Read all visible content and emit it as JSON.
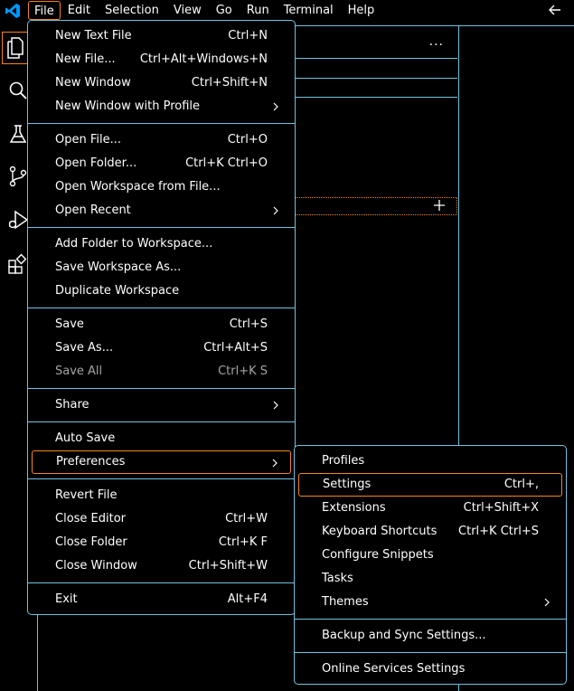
{
  "menubar": {
    "items": [
      "File",
      "Edit",
      "Selection",
      "View",
      "Go",
      "Run",
      "Terminal",
      "Help"
    ]
  },
  "file_menu": {
    "groups": [
      [
        {
          "label": "New Text File",
          "shortcut": "Ctrl+N"
        },
        {
          "label": "New File...",
          "shortcut": "Ctrl+Alt+Windows+N"
        },
        {
          "label": "New Window",
          "shortcut": "Ctrl+Shift+N"
        },
        {
          "label": "New Window with Profile",
          "submenu": true
        }
      ],
      [
        {
          "label": "Open File...",
          "shortcut": "Ctrl+O"
        },
        {
          "label": "Open Folder...",
          "shortcut": "Ctrl+K Ctrl+O"
        },
        {
          "label": "Open Workspace from File..."
        },
        {
          "label": "Open Recent",
          "submenu": true
        }
      ],
      [
        {
          "label": "Add Folder to Workspace..."
        },
        {
          "label": "Save Workspace As..."
        },
        {
          "label": "Duplicate Workspace"
        }
      ],
      [
        {
          "label": "Save",
          "shortcut": "Ctrl+S"
        },
        {
          "label": "Save As...",
          "shortcut": "Ctrl+Alt+S"
        },
        {
          "label": "Save All",
          "shortcut": "Ctrl+K S",
          "disabled": true
        }
      ],
      [
        {
          "label": "Share",
          "submenu": true
        }
      ],
      [
        {
          "label": "Auto Save"
        },
        {
          "label": "Preferences",
          "submenu": true,
          "highlight": true
        }
      ],
      [
        {
          "label": "Revert File"
        },
        {
          "label": "Close Editor",
          "shortcut": "Ctrl+W"
        },
        {
          "label": "Close Folder",
          "shortcut": "Ctrl+K F"
        },
        {
          "label": "Close Window",
          "shortcut": "Ctrl+Shift+W"
        }
      ],
      [
        {
          "label": "Exit",
          "shortcut": "Alt+F4"
        }
      ]
    ]
  },
  "preferences_menu": {
    "groups": [
      [
        {
          "label": "Profiles"
        },
        {
          "label": "Settings",
          "shortcut": "Ctrl+,",
          "highlight": true
        },
        {
          "label": "Extensions",
          "shortcut": "Ctrl+Shift+X"
        },
        {
          "label": "Keyboard Shortcuts",
          "shortcut": "Ctrl+K Ctrl+S"
        },
        {
          "label": "Configure Snippets"
        },
        {
          "label": "Tasks"
        },
        {
          "label": "Themes",
          "submenu": true
        }
      ],
      [
        {
          "label": "Backup and Sync Settings..."
        }
      ],
      [
        {
          "label": "Online Services Settings"
        }
      ]
    ]
  },
  "sidepanel": {
    "more_actions": "..."
  },
  "icons": {
    "app": "vscode-logo-icon",
    "back": "arrow-left-icon",
    "activity": [
      "explorer-icon",
      "search-icon",
      "testing-icon",
      "source-control-icon",
      "run-debug-icon",
      "extensions-icon"
    ]
  },
  "colors": {
    "background": "#000000",
    "border": "#6fc3df",
    "focus": "#f38518",
    "logo": "#0098ff",
    "disabled_text": "#a5a5a5"
  }
}
